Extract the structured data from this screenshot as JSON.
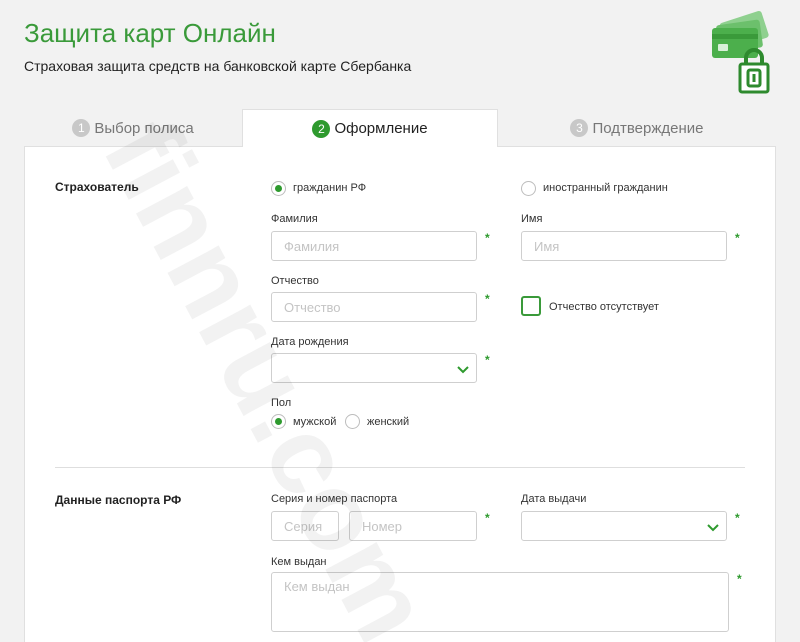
{
  "header": {
    "title": "Защита карт Онлайн",
    "subtitle": "Страховая защита средств на банковской карте Сбербанка"
  },
  "tabs": [
    {
      "num": "1",
      "label": "Выбор полиса",
      "active": false
    },
    {
      "num": "2",
      "label": "Оформление",
      "active": true
    },
    {
      "num": "3",
      "label": "Подтверждение",
      "active": false
    }
  ],
  "insured": {
    "section_label": "Страхователь",
    "citizenship_options": [
      {
        "label": "гражданин РФ",
        "selected": true
      },
      {
        "label": "иностранный гражданин",
        "selected": false
      }
    ],
    "surname": {
      "label": "Фамилия",
      "placeholder": "Фамилия",
      "value": ""
    },
    "name": {
      "label": "Имя",
      "placeholder": "Имя",
      "value": ""
    },
    "patronymic": {
      "label": "Отчество",
      "placeholder": "Отчество",
      "value": ""
    },
    "no_patronymic": {
      "label": "Отчество отсутствует",
      "checked": false
    },
    "birth_date": {
      "label": "Дата рождения",
      "value": ""
    },
    "gender": {
      "label": "Пол",
      "options": [
        {
          "label": "мужской",
          "selected": true
        },
        {
          "label": "женский",
          "selected": false
        }
      ]
    }
  },
  "passport": {
    "section_label": "Данные паспорта РФ",
    "series_number_label": "Серия и номер паспорта",
    "series": {
      "placeholder": "Серия",
      "value": ""
    },
    "number": {
      "placeholder": "Номер",
      "value": ""
    },
    "issue_date": {
      "label": "Дата выдачи",
      "value": ""
    },
    "issued_by": {
      "label": "Кем выдан",
      "placeholder": "Кем выдан",
      "value": ""
    }
  },
  "required_mark": "*",
  "watermark": "finnru.com",
  "colors": {
    "accent": "#2e9a2e",
    "title": "#3a9a3a",
    "border": "#cfcfcf",
    "background": "#f2f2f2"
  }
}
